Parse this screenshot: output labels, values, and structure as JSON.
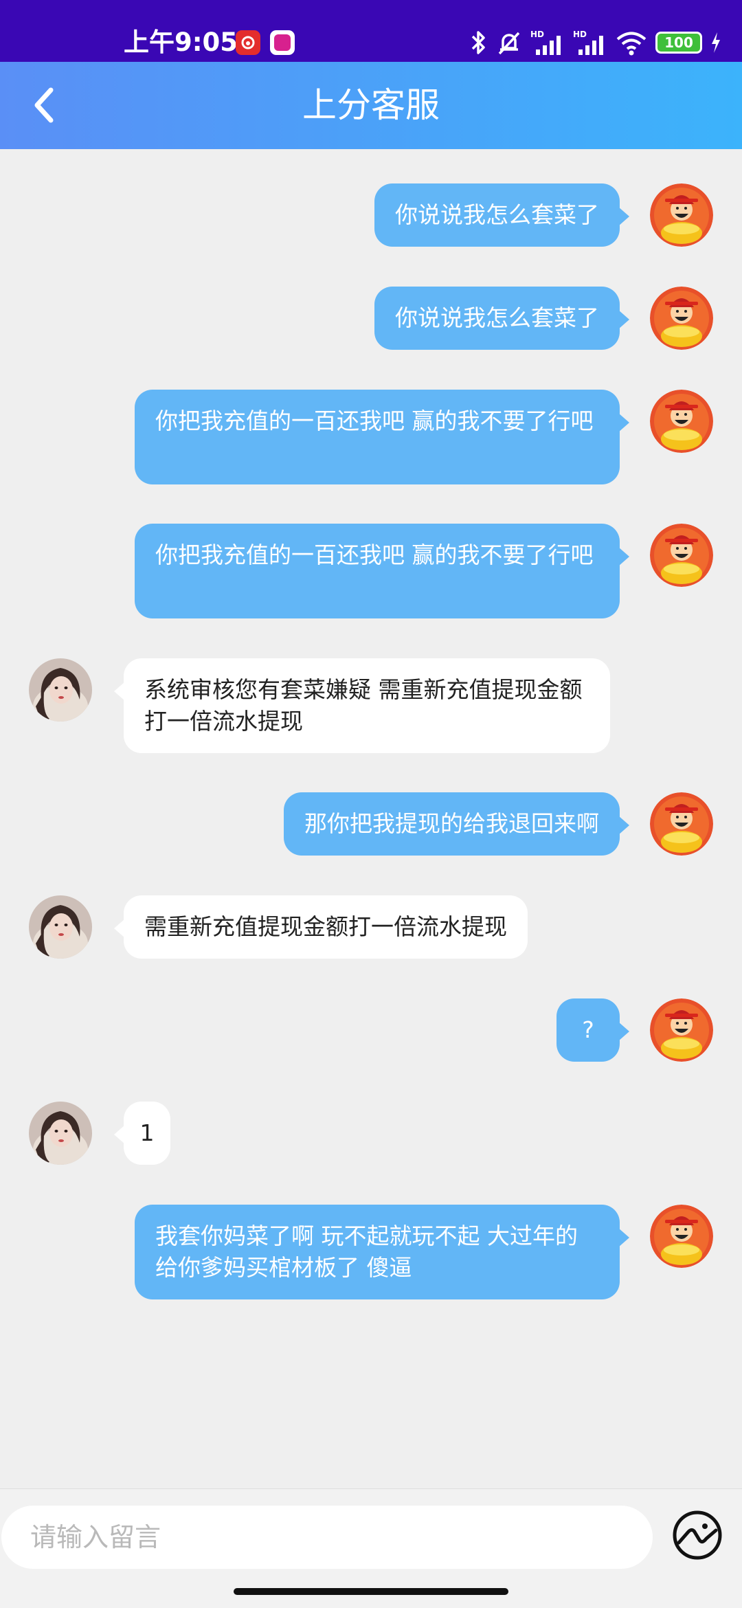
{
  "status_bar": {
    "time": "上午9:05",
    "battery": "100",
    "colors": {
      "background": "#3a07b4",
      "battery": "#3fbf3a"
    }
  },
  "header": {
    "title": "上分客服",
    "back_icon": "chevron-left-icon",
    "gradient": [
      "#5a8ff6",
      "#3cb3fb"
    ]
  },
  "messages": [
    {
      "side": "out",
      "text": "你说说我怎么套菜了"
    },
    {
      "side": "out",
      "text": "你说说我怎么套菜了"
    },
    {
      "side": "out",
      "text": "你把我充值的一百还我吧 赢的我不要了行吧"
    },
    {
      "side": "out",
      "text": "你把我充值的一百还我吧 赢的我不要了行吧"
    },
    {
      "side": "in",
      "text": "系统审核您有套菜嫌疑 需重新充值提现金额打一倍流水提现"
    },
    {
      "side": "out",
      "text": "那你把我提现的给我退回来啊"
    },
    {
      "side": "in",
      "text": "需重新充值提现金额打一倍流水提现"
    },
    {
      "side": "out",
      "text": "?"
    },
    {
      "side": "in",
      "text": "1"
    },
    {
      "side": "out",
      "text": "我套你妈菜了啊 玩不起就玩不起 大过年的给你爹妈买棺材板了 傻逼"
    }
  ],
  "composer": {
    "placeholder": "请输入留言",
    "image_icon": "image-picker-icon"
  },
  "colors": {
    "outgoing_bubble": "#62b6f6",
    "incoming_bubble": "#ffffff",
    "chat_background": "#efefef"
  }
}
